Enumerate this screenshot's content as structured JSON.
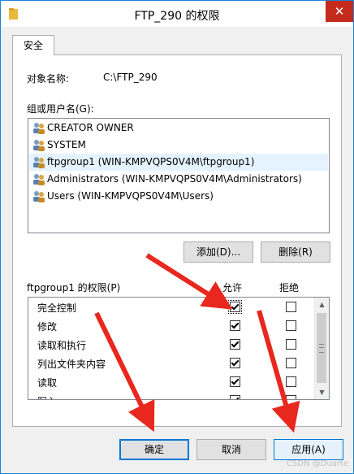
{
  "window": {
    "title": "FTP_290 的权限",
    "close_glyph": "✕"
  },
  "tab": {
    "label": "安全"
  },
  "object": {
    "label": "对象名称:",
    "value": "C:\\FTP_290"
  },
  "groups": {
    "label": "组或用户名(G):",
    "items": [
      {
        "name": "CREATOR OWNER",
        "selected": false
      },
      {
        "name": "SYSTEM",
        "selected": false
      },
      {
        "name": "ftpgroup1 (WIN-KMPVQPS0V4M\\ftpgroup1)",
        "selected": true
      },
      {
        "name": "Administrators (WIN-KMPVQPS0V4M\\Administrators)",
        "selected": false
      },
      {
        "name": "Users (WIN-KMPVQPS0V4M\\Users)",
        "selected": false
      }
    ],
    "add_label": "添加(D)...",
    "remove_label": "删除(R)"
  },
  "permissions": {
    "label": "ftpgroup1 的权限(P)",
    "allow_label": "允许",
    "deny_label": "拒绝",
    "rows": [
      {
        "name": "完全控制",
        "allow": true,
        "deny": false
      },
      {
        "name": "修改",
        "allow": true,
        "deny": false
      },
      {
        "name": "读取和执行",
        "allow": true,
        "deny": false
      },
      {
        "name": "列出文件夹内容",
        "allow": true,
        "deny": false
      },
      {
        "name": "读取",
        "allow": true,
        "deny": false
      },
      {
        "name": "写入",
        "allow": true,
        "deny": false
      }
    ]
  },
  "footer": {
    "ok_label": "确定",
    "cancel_label": "取消",
    "apply_label": "应用(A)"
  },
  "watermark": "CSDN @Duarte",
  "colors": {
    "accent": "#0078d7",
    "close": "#c42b1c",
    "selection": "#e5f3ff",
    "annotation_arrow": "#e8281e"
  },
  "icons": [
    "folder-icon",
    "user-group-icon",
    "checkmark-icon",
    "scroll-up-icon",
    "scroll-down-icon",
    "annotation-arrow"
  ]
}
